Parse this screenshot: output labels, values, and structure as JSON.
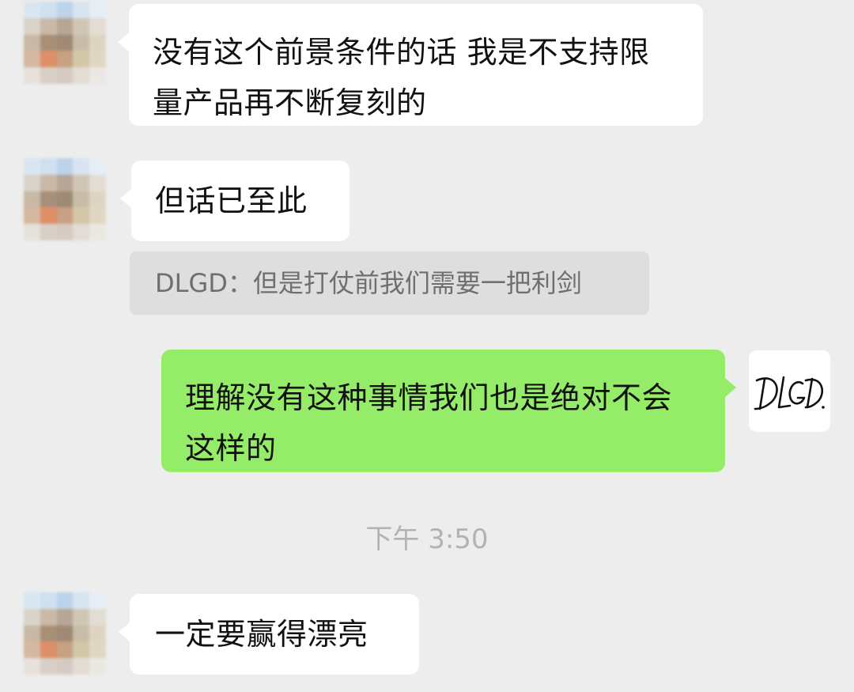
{
  "messages": [
    {
      "side": "left",
      "text": "没有这个前景条件的话 我是不支持限量产品再不断复刻的"
    },
    {
      "side": "left",
      "text": "但话已至此"
    },
    {
      "side": "left",
      "type": "quote",
      "text": "DLGD：但是打仗前我们需要一把利剑"
    },
    {
      "side": "right",
      "text": "理解没有这种事情我们也是绝对不会这样的"
    },
    {
      "side": "left",
      "text": "一定要赢得漂亮"
    }
  ],
  "timestamp": "下午 3:50",
  "sender_avatar": {
    "label": "DLGD."
  },
  "colors": {
    "background": "#ededed",
    "incoming_bubble": "#ffffff",
    "outgoing_bubble": "#95ec69",
    "quote_background": "#dedede",
    "quote_text": "#6f6f6f",
    "timestamp_text": "#b2b2b2"
  }
}
